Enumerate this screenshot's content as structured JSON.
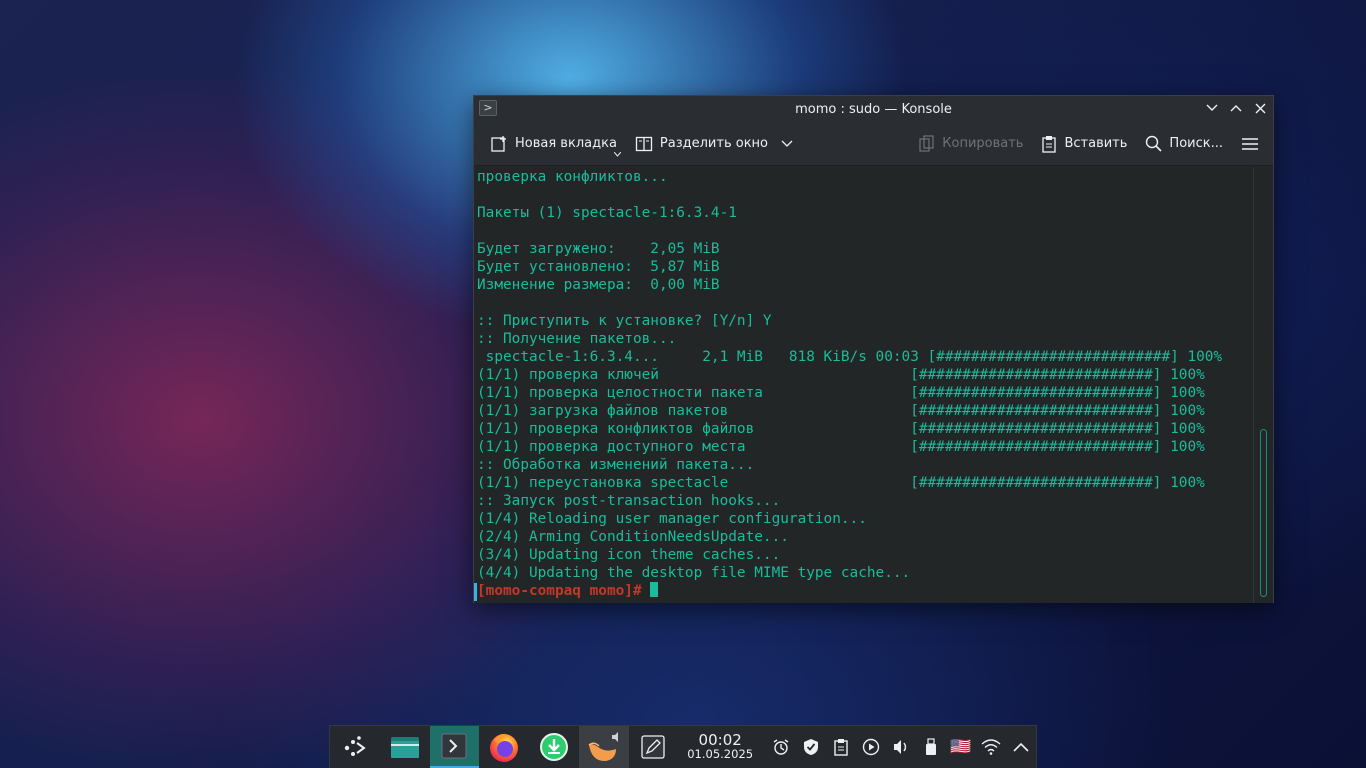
{
  "window": {
    "title": "momo : sudo — Konsole"
  },
  "toolbar": {
    "new_tab": "Новая вкладка",
    "split": "Разделить окно",
    "copy": "Копировать",
    "paste": "Вставить",
    "search": "Поиск..."
  },
  "terminal": {
    "lines": [
      "проверка конфликтов...",
      "",
      "Пакеты (1) spectacle-1:6.3.4-1",
      "",
      "Будет загружено:    2,05 MiB",
      "Будет установлено:  5,87 MiB",
      "Изменение размера:  0,00 MiB",
      "",
      ":: Приступить к установке? [Y/n] Y",
      ":: Получение пакетов...",
      " spectacle-1:6.3.4...     2,1 MiB   818 KiB/s 00:03 [###########################] 100%",
      "(1/1) проверка ключей                             [###########################] 100%",
      "(1/1) проверка целостности пакета                 [###########################] 100%",
      "(1/1) загрузка файлов пакетов                     [###########################] 100%",
      "(1/1) проверка конфликтов файлов                  [###########################] 100%",
      "(1/1) проверка доступного места                   [###########################] 100%",
      ":: Обработка изменений пакета...",
      "(1/1) переустановка spectacle                     [###########################] 100%",
      ":: Запуск post-transaction hooks...",
      "(1/4) Reloading user manager configuration...",
      "(2/4) Arming ConditionNeedsUpdate...",
      "(3/4) Updating icon theme caches...",
      "(4/4) Updating the desktop file MIME type cache..."
    ],
    "prompt_user": "[momo-compaq",
    "prompt_dir": " momo",
    "prompt_end": "]#"
  },
  "taskbar": {
    "time": "00:02",
    "date": "01.05.2025",
    "tray_flag": "🇺🇸"
  },
  "colors": {
    "terminal_text": "#1abc9c",
    "prompt_red": "#c0392b",
    "accent": "#3daee9"
  }
}
